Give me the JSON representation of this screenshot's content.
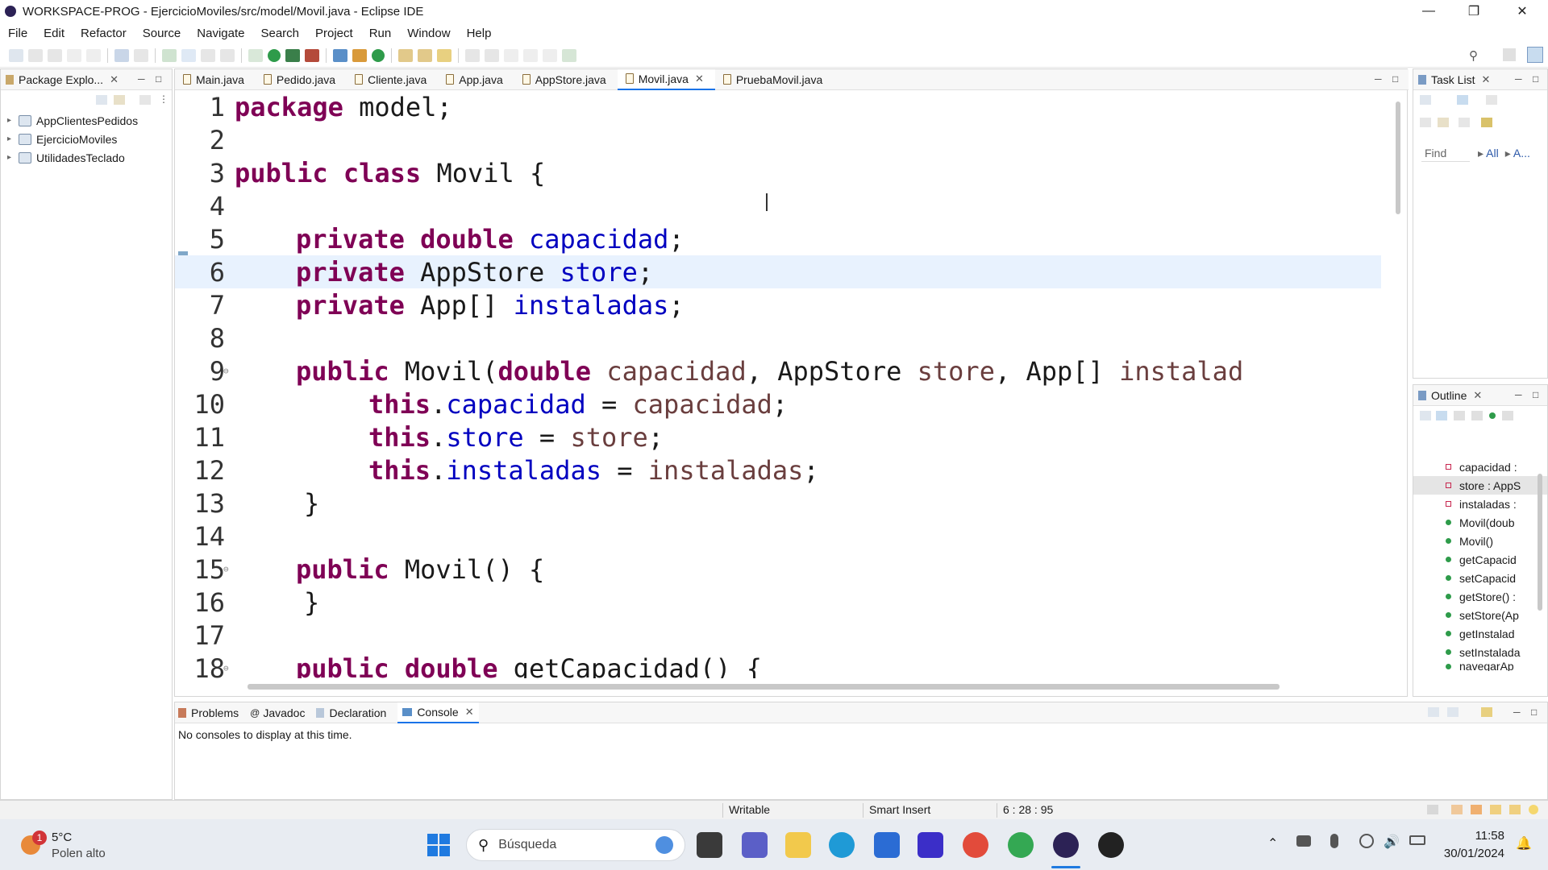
{
  "window": {
    "title": "WORKSPACE-PROG - EjercicioMoviles/src/model/Movil.java - Eclipse IDE"
  },
  "menu": [
    "File",
    "Edit",
    "Refactor",
    "Source",
    "Navigate",
    "Search",
    "Project",
    "Run",
    "Window",
    "Help"
  ],
  "package_explorer": {
    "title": "Package Explo...",
    "projects": [
      "AppClientesPedidos",
      "EjercicioMoviles",
      "UtilidadesTeclado"
    ]
  },
  "editor": {
    "tabs": [
      "Main.java",
      "Pedido.java",
      "Cliente.java",
      "App.java",
      "AppStore.java",
      "Movil.java",
      "PruebaMovil.java"
    ],
    "active_tab": "Movil.java",
    "lines": [
      {
        "n": "1"
      },
      {
        "n": "2"
      },
      {
        "n": "3"
      },
      {
        "n": "4"
      },
      {
        "n": "5"
      },
      {
        "n": "6"
      },
      {
        "n": "7"
      },
      {
        "n": "8"
      },
      {
        "n": "9"
      },
      {
        "n": "10"
      },
      {
        "n": "11"
      },
      {
        "n": "12"
      },
      {
        "n": "13"
      },
      {
        "n": "14"
      },
      {
        "n": "15"
      },
      {
        "n": "16"
      },
      {
        "n": "17"
      },
      {
        "n": "18"
      }
    ],
    "code": {
      "l1_kw": "package",
      "l1_rest": " model;",
      "l3_kw": "public class",
      "l3_rest": " Movil {",
      "l5_kw": "private double",
      "l5_fld": "capacidad",
      "l5_end": ";",
      "l6_kw": "private",
      "l6_type": " AppStore ",
      "l6_fld": "store",
      "l6_end": ";",
      "l7_kw": "private",
      "l7_type": " App[] ",
      "l7_fld": "instaladas",
      "l7_end": ";",
      "l9_kw": "public",
      "l9_a": " Movil(",
      "l9_kw2": "double",
      "l9_p1": "capacidad",
      "l9_b": ", AppStore ",
      "l9_p2": "store",
      "l9_c": ", App[] ",
      "l9_p3": "instalad",
      "l10_kw": "this",
      "l10_fld": "capacidad",
      "l10_mid": " = ",
      "l10_par": "capacidad",
      "l10_end": ";",
      "l11_kw": "this",
      "l11_fld": "store",
      "l11_mid": " = ",
      "l11_par": "store",
      "l11_end": ";",
      "l12_kw": "this",
      "l12_fld": "instaladas",
      "l12_mid": " = ",
      "l12_par": "instaladas",
      "l12_end": ";",
      "l13": "}",
      "l15_kw": "public",
      "l15_rest": " Movil() {",
      "l16": "}",
      "l18_kw": "public double",
      "l18_rest": " getCapacidad() {"
    }
  },
  "task_list": {
    "title": "Task List",
    "find_placeholder": "Find",
    "all": "All",
    "activate": "A..."
  },
  "outline": {
    "title": "Outline",
    "items": [
      {
        "label": "capacidad :",
        "kind": "field"
      },
      {
        "label": "store : AppS",
        "kind": "field"
      },
      {
        "label": "instaladas :",
        "kind": "field"
      },
      {
        "label": "Movil(doub",
        "kind": "method"
      },
      {
        "label": "Movil()",
        "kind": "method"
      },
      {
        "label": "getCapacid",
        "kind": "method"
      },
      {
        "label": "setCapacid",
        "kind": "method"
      },
      {
        "label": "getStore() :",
        "kind": "method"
      },
      {
        "label": "setStore(Ap",
        "kind": "method"
      },
      {
        "label": "getInstalad",
        "kind": "method"
      },
      {
        "label": "setInstalada",
        "kind": "method"
      },
      {
        "label": "navegarAp",
        "kind": "method"
      }
    ],
    "selected_index": 1
  },
  "bottom_panel": {
    "tabs": [
      "Problems",
      "Javadoc",
      "Declaration",
      "Console"
    ],
    "active_tab": "Console",
    "message": "No consoles to display at this time."
  },
  "status": {
    "writable": "Writable",
    "insert_mode": "Smart Insert",
    "position": "6 : 28 : 95"
  },
  "taskbar": {
    "weather_temp": "5°C",
    "weather_note": "Polen alto",
    "weather_badge": "1",
    "search_placeholder": "Búsqueda",
    "time": "11:58",
    "date": "30/01/2024"
  },
  "colors": {
    "keyword": "#7f0055",
    "field": "#0000c0",
    "parameter": "#6a3e3e",
    "current_line": "#e8f2fe",
    "accent": "#1a73e8"
  }
}
